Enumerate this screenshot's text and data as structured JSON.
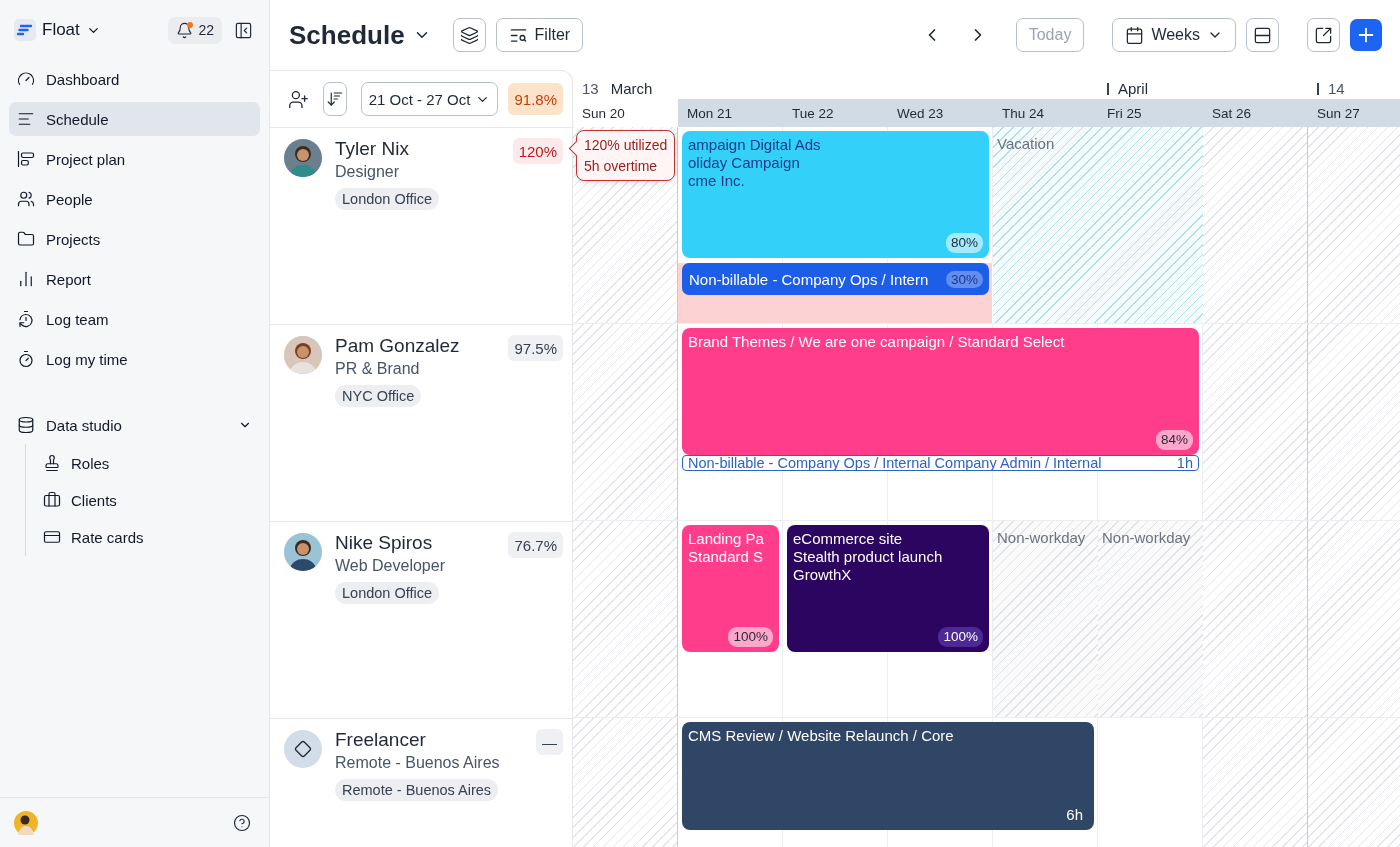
{
  "sidebar": {
    "workspace": "Float",
    "notifications": "22",
    "nav": [
      {
        "label": "Dashboard",
        "selected": false
      },
      {
        "label": "Schedule",
        "selected": true
      },
      {
        "label": "Project plan",
        "selected": false
      },
      {
        "label": "People",
        "selected": false
      },
      {
        "label": "Projects",
        "selected": false
      },
      {
        "label": "Report",
        "selected": false
      },
      {
        "label": "Log team",
        "selected": false
      },
      {
        "label": "Log my time",
        "selected": false
      }
    ],
    "section": {
      "label": "Data studio",
      "expanded": true,
      "items": [
        {
          "label": "Roles"
        },
        {
          "label": "Clients"
        },
        {
          "label": "Rate cards"
        }
      ]
    }
  },
  "toolbar": {
    "title": "Schedule",
    "filter": "Filter",
    "today": {
      "label": "Today",
      "disabled": true
    },
    "view": "Weeks"
  },
  "people_header": {
    "date_range": "21 Oct - 27 Oct",
    "utilization": "91.8%",
    "warning": true
  },
  "timeline": {
    "weeks": [
      {
        "week": "13",
        "month": "March"
      },
      {
        "month": "April"
      },
      {
        "week": "14"
      }
    ],
    "days": [
      {
        "label": "Sun 20",
        "weekend": true,
        "in_range": false
      },
      {
        "label": "Mon 21",
        "weekend": false,
        "in_range": true
      },
      {
        "label": "Tue 22",
        "weekend": false,
        "in_range": true
      },
      {
        "label": "Wed 23",
        "weekend": false,
        "in_range": true
      },
      {
        "label": "Thu 24",
        "weekend": false,
        "in_range": true
      },
      {
        "label": "Fri 25",
        "weekend": false,
        "in_range": true
      },
      {
        "label": "Sat 26",
        "weekend": true,
        "in_range": true
      },
      {
        "label": "Sun 27",
        "weekend": true,
        "in_range": true
      }
    ]
  },
  "tooltip": {
    "lines": [
      "120% utilized",
      "5h overtime"
    ]
  },
  "people": [
    {
      "kind": "person",
      "name": "Tyler Nix",
      "role": "Designer",
      "office": "London Office",
      "utilization": "120%",
      "overallocated": true,
      "time_off": [
        {
          "kind": "overtime"
        },
        {
          "kind": "vacation",
          "label": "Vacation"
        }
      ],
      "events": [
        {
          "kind": "task",
          "lines": [
            "ampaign Digital Ads",
            "oliday Campaign",
            "cme Inc."
          ],
          "badge": "80%",
          "color": "#33d1fa"
        },
        {
          "kind": "bar",
          "lines": [
            "Non-billable - Company Ops / Intern"
          ],
          "badge": "30%",
          "color": "#1d5ee8"
        }
      ]
    },
    {
      "kind": "person",
      "name": "Pam Gonzalez",
      "role": "PR & Brand",
      "office": "NYC Office",
      "utilization": "97.5%",
      "overallocated": false,
      "events": [
        {
          "kind": "task",
          "lines": [
            "Brand Themes / We are one campaign / Standard Select"
          ],
          "badge": "84%",
          "color": "#ff3d8b"
        },
        {
          "kind": "outline",
          "lines": [
            "Non-billable - Company Ops / Internal Company Admin / Internal"
          ],
          "badge": "1h",
          "color": "#2a64c4"
        }
      ]
    },
    {
      "kind": "person",
      "name": "Nike Spiros",
      "role": "Web Developer",
      "office": "London Office",
      "utilization": "76.7%",
      "overallocated": false,
      "time_off": [
        {
          "kind": "nonworkday",
          "label": "Non-workday"
        },
        {
          "kind": "nonworkday",
          "label": "Non-workday"
        }
      ],
      "events": [
        {
          "kind": "task",
          "lines": [
            "Landing Pa",
            "Standard S"
          ],
          "badge": "100%",
          "color": "#ff3d8b"
        },
        {
          "kind": "task",
          "lines": [
            "eCommerce site",
            "Stealth product launch",
            "GrowthX"
          ],
          "badge": "100%",
          "color": "#2b0560"
        }
      ]
    },
    {
      "kind": "placeholder",
      "name": "Freelancer",
      "role": "Remote - Buenos Aires",
      "office": "Remote - Buenos Aires",
      "utilization": "—",
      "overallocated": false,
      "events": [
        {
          "kind": "task",
          "lines": [
            "CMS Review / Website Relaunch / Core"
          ],
          "badge": "6h",
          "color": "#2f4667"
        }
      ]
    }
  ]
}
